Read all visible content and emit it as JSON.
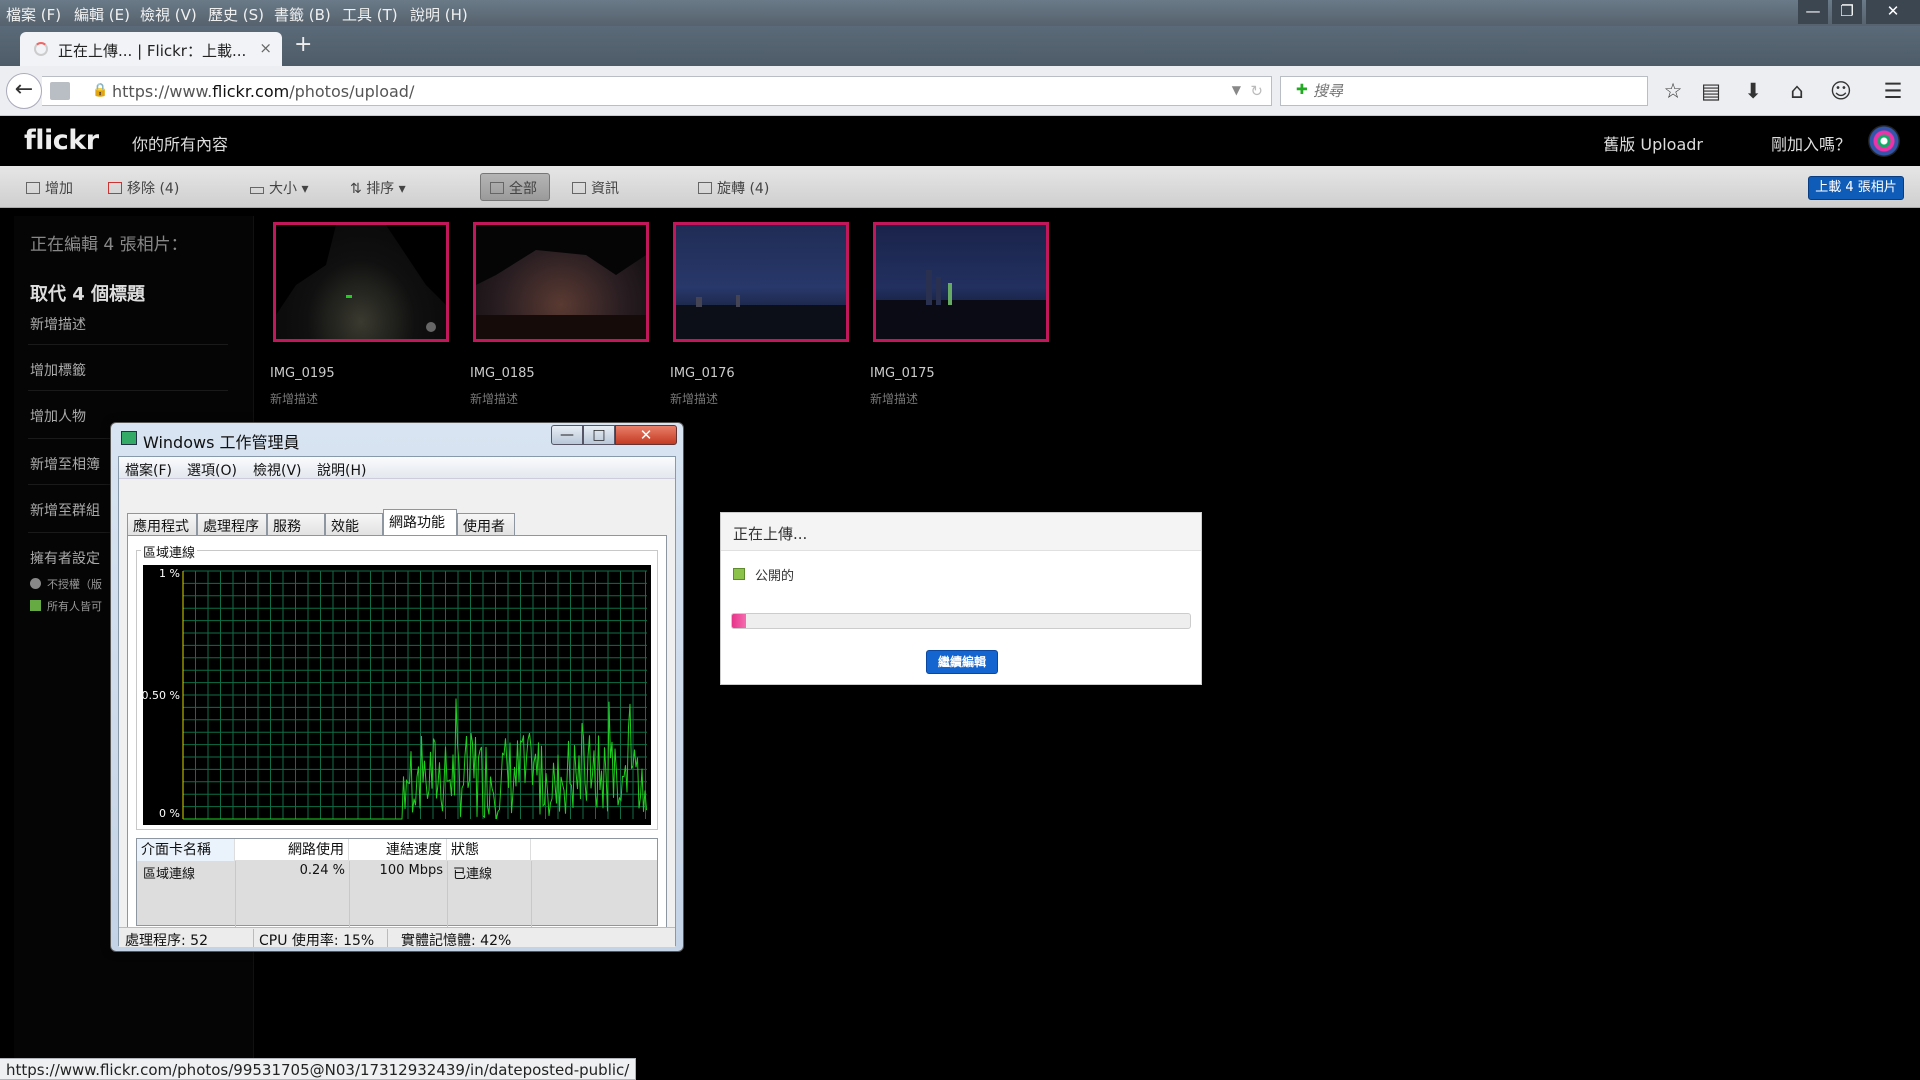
{
  "browser": {
    "menu": [
      "檔案 (F)",
      "編輯 (E)",
      "檢視 (V)",
      "歷史 (S)",
      "書籤 (B)",
      "工具 (T)",
      "說明 (H)"
    ],
    "window_controls": {
      "minimize": "—",
      "restore": "❐",
      "close": "✕"
    },
    "tab_title": "正在上傳... | Flickr：上載...",
    "tab_close": "×",
    "new_tab": "+",
    "back": "←",
    "url_prefix": "https://www.",
    "url_host": "flickr.com",
    "url_path": "/photos/upload/",
    "search_placeholder": "搜尋",
    "status_url": "https://www.flickr.com/photos/99531705@N03/17312932439/in/dateposted-public/"
  },
  "flickr": {
    "logo": "flickr",
    "you_all": "你的所有內容",
    "old_uploadr": "舊版 Uploadr",
    "just_joined": "剛加入嗎？",
    "toolbar": {
      "add": "增加",
      "remove": "移除 (4)",
      "size": "大小",
      "sort": "排序",
      "all": "全部",
      "info": "資訊",
      "rotate": "旋轉 (4)",
      "upload": "上載 4 張相片"
    },
    "sidebar": {
      "editing": "正在編輯 4 張相片：",
      "replace_titles": "取代 4 個標題",
      "add_description": "新增描述",
      "add_tags": "增加標籤",
      "add_people": "增加人物",
      "add_to_album": "新增至相簿",
      "add_to_group": "新增至群組",
      "owner_settings": "擁有者設定",
      "no_license": "不授權（版",
      "anyone_can": "所有人皆可"
    },
    "photos": [
      {
        "name": "IMG_0195",
        "desc": "新增描述"
      },
      {
        "name": "IMG_0185",
        "desc": "新增描述"
      },
      {
        "name": "IMG_0176",
        "desc": "新增描述"
      },
      {
        "name": "IMG_0175",
        "desc": "新增描述"
      }
    ],
    "upload_dialog": {
      "title": "正在上傳...",
      "privacy": "公開的",
      "progress": 0.03,
      "continue": "繼續編輯"
    }
  },
  "taskmgr": {
    "title": "Windows 工作管理員",
    "menu": [
      "檔案(F)",
      "選項(O)",
      "檢視(V)",
      "說明(H)"
    ],
    "tabs": [
      "應用程式",
      "處理程序",
      "服務",
      "效能",
      "網路功能",
      "使用者"
    ],
    "active_tab": 4,
    "group_label": "區域連線",
    "graph": {
      "y_labels": [
        "1 %",
        "0.50 %",
        "0 %"
      ],
      "ymax": 1.0,
      "color": "#20d020"
    },
    "columns": [
      "介面卡名稱",
      "網路使用",
      "連結速度",
      "狀態"
    ],
    "row": [
      "區域連線",
      "0.24 %",
      "100 Mbps",
      "已連線"
    ],
    "status": {
      "processes": "處理程序: 52",
      "cpu": "CPU 使用率: 15%",
      "memory": "實體記憶體: 42%"
    }
  }
}
